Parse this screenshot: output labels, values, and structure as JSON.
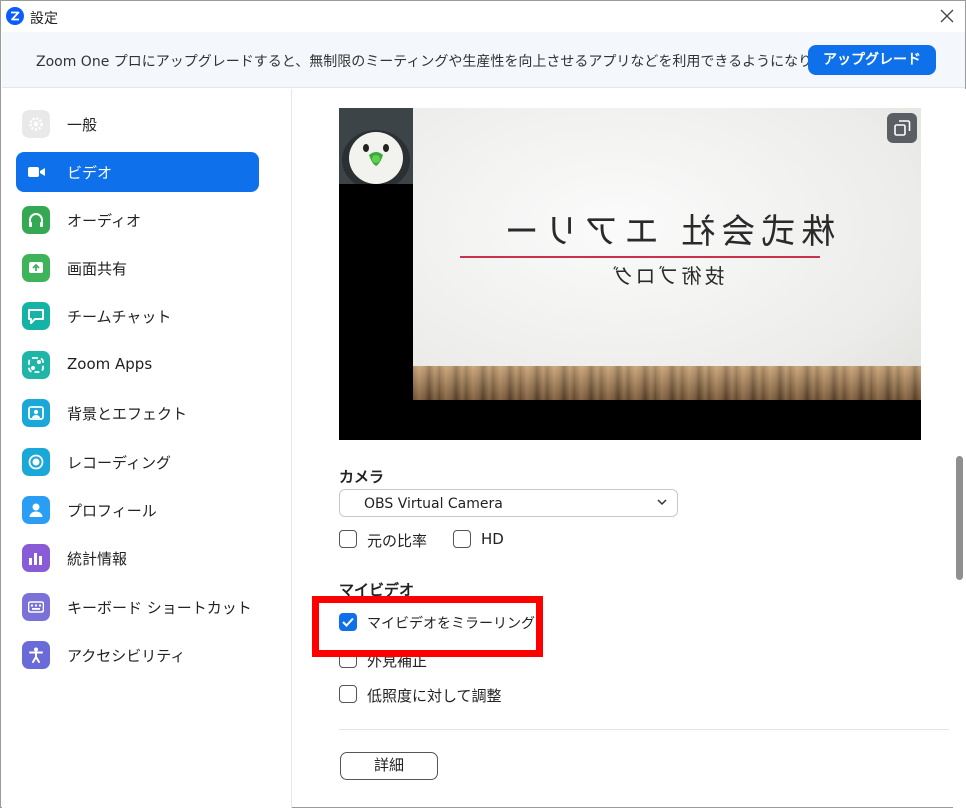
{
  "window": {
    "title": "設定"
  },
  "banner": {
    "text": "Zoom One プロにアップグレードすると、無制限のミーティングや生産性を向上させるアプリなどを利用できるようになります！",
    "upgrade_label": "アップグレード"
  },
  "sidebar": {
    "items": [
      {
        "label": "一般",
        "icon": "gear-icon",
        "color": "#e9e9e9",
        "active": false
      },
      {
        "label": "ビデオ",
        "icon": "video-camera-icon",
        "color": "#0e71eb",
        "active": true
      },
      {
        "label": "オーディオ",
        "icon": "headphones-icon",
        "color": "#34a853",
        "active": false
      },
      {
        "label": "画面共有",
        "icon": "share-screen-icon",
        "color": "#3fb35a",
        "active": false
      },
      {
        "label": "チームチャット",
        "icon": "chat-icon",
        "color": "#14b3a6",
        "active": false
      },
      {
        "label": "Zoom Apps",
        "icon": "apps-icon",
        "color": "#1fb6a8",
        "active": false
      },
      {
        "label": "背景とエフェクト",
        "icon": "background-icon",
        "color": "#1aa8d8",
        "active": false
      },
      {
        "label": "レコーディング",
        "icon": "record-icon",
        "color": "#1aa8d8",
        "active": false
      },
      {
        "label": "プロフィール",
        "icon": "profile-icon",
        "color": "#2a9df4",
        "active": false
      },
      {
        "label": "統計情報",
        "icon": "statistics-icon",
        "color": "#8a5bd6",
        "active": false
      },
      {
        "label": "キーボード ショートカット",
        "icon": "keyboard-icon",
        "color": "#7b72d9",
        "active": false
      },
      {
        "label": "アクセシビリティ",
        "icon": "accessibility-icon",
        "color": "#6a6ad8",
        "active": false
      }
    ]
  },
  "preview": {
    "slide_title": "株式会社 エアリー",
    "slide_subtitle": "技術ブログ"
  },
  "camera": {
    "label": "カメラ",
    "selected": "OBS Virtual Camera"
  },
  "options": {
    "original_ratio": {
      "label": "元の比率",
      "checked": false
    },
    "hd": {
      "label": "HD",
      "checked": false
    }
  },
  "my_video": {
    "label": "マイビデオ",
    "mirror": {
      "label": "マイビデオをミラーリング",
      "checked": true
    },
    "touch_up": {
      "label": "外見補正",
      "checked": false
    },
    "low_light": {
      "label": "低照度に対して調整",
      "checked": false
    }
  },
  "detail_button": "詳細",
  "colors": {
    "accent": "#0e71eb",
    "highlight": "#ff0000"
  }
}
